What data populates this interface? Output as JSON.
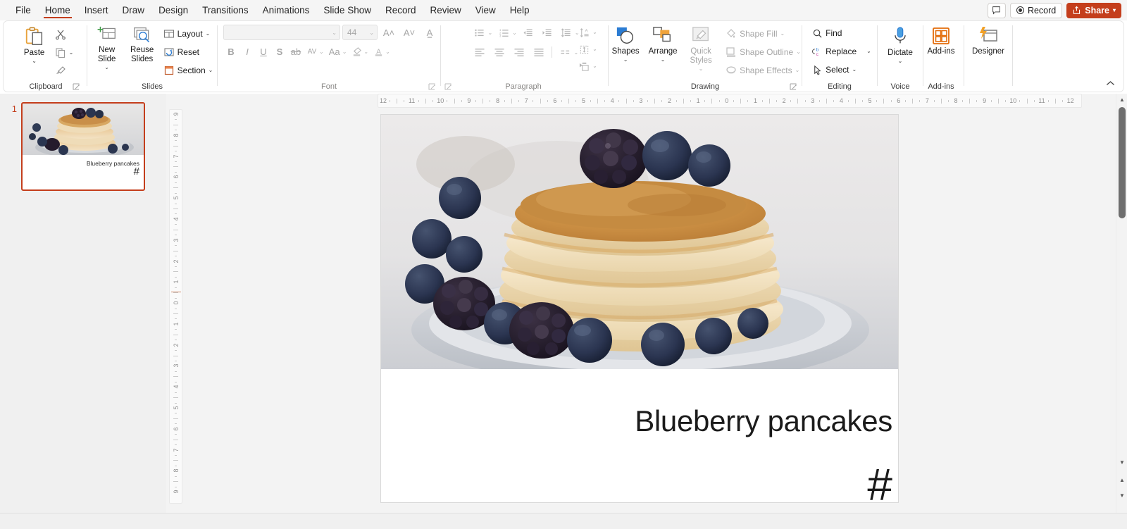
{
  "app": {
    "name": "PowerPoint",
    "accent": "#c43e1c",
    "ribbon_bg": "#ffffff",
    "workspace_bg": "#f3f3f3"
  },
  "titlebar": {
    "tabs": [
      {
        "label": "File",
        "active": false
      },
      {
        "label": "Home",
        "active": true
      },
      {
        "label": "Insert",
        "active": false
      },
      {
        "label": "Draw",
        "active": false
      },
      {
        "label": "Design",
        "active": false
      },
      {
        "label": "Transitions",
        "active": false
      },
      {
        "label": "Animations",
        "active": false
      },
      {
        "label": "Slide Show",
        "active": false
      },
      {
        "label": "Record",
        "active": false
      },
      {
        "label": "Review",
        "active": false
      },
      {
        "label": "View",
        "active": false
      },
      {
        "label": "Help",
        "active": false
      }
    ],
    "comments_icon": "comment-icon",
    "record_label": "Record",
    "record_icon": "record-circle-icon",
    "share_label": "Share",
    "share_icon": "share-icon",
    "share_chevron": "chevron-down-icon"
  },
  "ribbon": {
    "collapse_icon": "chevron-up-icon",
    "groups": [
      {
        "name": "clipboard",
        "label": "Clipboard",
        "dimmed": false,
        "has_dialog_launcher": true,
        "items": [
          {
            "name": "paste",
            "label": "Paste",
            "icon": "clipboard-icon",
            "has_chevron": true
          },
          {
            "name": "cut",
            "label": "Cut",
            "icon": "scissors-icon"
          },
          {
            "name": "copy",
            "label": "Copy",
            "icon": "copy-icon",
            "has_chevron": true
          },
          {
            "name": "format-painter",
            "label": "Format Painter",
            "icon": "paintbrush-icon"
          }
        ]
      },
      {
        "name": "slides",
        "label": "Slides",
        "dimmed": false,
        "has_dialog_launcher": false,
        "items": [
          {
            "name": "new-slide",
            "label": "New Slide",
            "icon": "new-slide-icon",
            "has_chevron": true
          },
          {
            "name": "reuse-slides",
            "label": "Reuse Slides",
            "icon": "reuse-slides-icon"
          },
          {
            "name": "layout",
            "label": "Layout",
            "icon": "layout-icon",
            "has_chevron": true
          },
          {
            "name": "reset",
            "label": "Reset",
            "icon": "reset-icon"
          },
          {
            "name": "section",
            "label": "Section",
            "icon": "section-icon",
            "has_chevron": true
          }
        ]
      },
      {
        "name": "font",
        "label": "Font",
        "dimmed": true,
        "has_dialog_launcher": true,
        "font_name_value": "",
        "font_name_placeholder": "",
        "font_size_value": "44",
        "items": [
          {
            "name": "increase-font-size",
            "label": "Increase Font Size",
            "icon": "increase-font-icon"
          },
          {
            "name": "decrease-font-size",
            "label": "Decrease Font Size",
            "icon": "decrease-font-icon"
          },
          {
            "name": "clear-formatting",
            "label": "Clear All Formatting",
            "icon": "clear-format-icon"
          },
          {
            "name": "bold",
            "label": "B",
            "icon": "bold-icon"
          },
          {
            "name": "italic",
            "label": "I",
            "icon": "italic-icon"
          },
          {
            "name": "underline",
            "label": "U",
            "icon": "underline-icon"
          },
          {
            "name": "text-shadow",
            "label": "S",
            "icon": "text-shadow-icon"
          },
          {
            "name": "strikethrough",
            "label": "ab",
            "icon": "strikethrough-icon"
          },
          {
            "name": "character-spacing",
            "label": "AV",
            "icon": "character-spacing-icon"
          },
          {
            "name": "change-case",
            "label": "Aa",
            "icon": "change-case-icon"
          },
          {
            "name": "text-highlight-color",
            "label": "Text Highlight Color",
            "icon": "highlighter-icon"
          },
          {
            "name": "font-color",
            "label": "Font Color",
            "icon": "font-color-icon"
          }
        ]
      },
      {
        "name": "paragraph",
        "label": "Paragraph",
        "dimmed": true,
        "has_dialog_launcher": true,
        "items": [
          {
            "name": "bullets",
            "label": "Bullets",
            "icon": "bullets-icon",
            "has_chevron": true
          },
          {
            "name": "numbering",
            "label": "Numbering",
            "icon": "numbering-icon",
            "has_chevron": true
          },
          {
            "name": "decrease-indent",
            "label": "Decrease List Level",
            "icon": "decrease-indent-icon"
          },
          {
            "name": "increase-indent",
            "label": "Increase List Level",
            "icon": "increase-indent-icon"
          },
          {
            "name": "line-spacing",
            "label": "Line Spacing",
            "icon": "line-spacing-icon",
            "has_chevron": true
          },
          {
            "name": "text-direction",
            "label": "Text Direction",
            "icon": "text-direction-icon",
            "has_chevron": true
          },
          {
            "name": "align-text",
            "label": "Align Text",
            "icon": "align-text-icon",
            "has_chevron": true
          },
          {
            "name": "convert-to-smartart",
            "label": "Convert to SmartArt",
            "icon": "smartart-icon",
            "has_chevron": true
          },
          {
            "name": "align-left",
            "label": "Align Left",
            "icon": "align-left-icon"
          },
          {
            "name": "center",
            "label": "Center",
            "icon": "align-center-icon"
          },
          {
            "name": "align-right",
            "label": "Align Right",
            "icon": "align-right-icon"
          },
          {
            "name": "justify",
            "label": "Justify",
            "icon": "align-justify-icon"
          },
          {
            "name": "columns",
            "label": "Columns",
            "icon": "columns-icon",
            "has_chevron": true
          }
        ]
      },
      {
        "name": "drawing",
        "label": "Drawing",
        "dimmed": false,
        "has_dialog_launcher": true,
        "items": [
          {
            "name": "shapes",
            "label": "Shapes",
            "icon": "shapes-icon",
            "has_chevron": true
          },
          {
            "name": "arrange",
            "label": "Arrange",
            "icon": "arrange-icon",
            "has_chevron": true
          },
          {
            "name": "quick-styles",
            "label": "Quick Styles",
            "icon": "quick-styles-icon",
            "has_chevron": true
          },
          {
            "name": "shape-fill",
            "label": "Shape Fill",
            "icon": "shape-fill-icon",
            "has_chevron": true
          },
          {
            "name": "shape-outline",
            "label": "Shape Outline",
            "icon": "shape-outline-icon",
            "has_chevron": true
          },
          {
            "name": "shape-effects",
            "label": "Shape Effects",
            "icon": "shape-effects-icon",
            "has_chevron": true
          }
        ]
      },
      {
        "name": "editing",
        "label": "Editing",
        "dimmed": false,
        "has_dialog_launcher": false,
        "items": [
          {
            "name": "find",
            "label": "Find",
            "icon": "search-icon"
          },
          {
            "name": "replace",
            "label": "Replace",
            "icon": "replace-icon",
            "has_chevron": true
          },
          {
            "name": "select",
            "label": "Select",
            "icon": "cursor-icon",
            "has_chevron": true
          }
        ]
      },
      {
        "name": "voice",
        "label": "Voice",
        "dimmed": false,
        "has_dialog_launcher": false,
        "items": [
          {
            "name": "dictate",
            "label": "Dictate",
            "icon": "microphone-icon",
            "has_chevron": true
          }
        ]
      },
      {
        "name": "add-ins",
        "label": "Add-ins",
        "dimmed": false,
        "has_dialog_launcher": false,
        "items": [
          {
            "name": "add-ins",
            "label": "Add-ins",
            "icon": "add-ins-grid-icon"
          }
        ]
      },
      {
        "name": "designer",
        "label": "",
        "dimmed": false,
        "has_dialog_launcher": false,
        "items": [
          {
            "name": "designer",
            "label": "Designer",
            "icon": "designer-icon"
          }
        ]
      }
    ]
  },
  "thumbnails": {
    "slides": [
      {
        "number": "1",
        "title": "Blueberry pancakes",
        "hash": "#",
        "selected": true
      }
    ]
  },
  "rulers": {
    "horizontal_ticks": [
      "12",
      "11",
      "10",
      "9",
      "8",
      "7",
      "6",
      "5",
      "4",
      "3",
      "2",
      "1",
      "0",
      "1",
      "2",
      "3",
      "4",
      "5",
      "6",
      "7",
      "8",
      "9",
      "10",
      "11",
      "12"
    ],
    "vertical_ticks": [
      "9",
      "8",
      "7",
      "6",
      "5",
      "4",
      "3",
      "2",
      "1",
      "0",
      "1",
      "2",
      "3",
      "4",
      "5",
      "6",
      "7",
      "8",
      "9"
    ]
  },
  "slide": {
    "title": "Blueberry pancakes",
    "hash": "#",
    "image_alt": "Stack of blueberry pancakes with blackberries and blueberries on a grey plate"
  },
  "scrollbar": {
    "up_arrow": "triangle-up-icon",
    "down_arrow": "triangle-down-icon",
    "previous_slide": "previous-slide-icon",
    "next_slide": "next-slide-icon"
  }
}
